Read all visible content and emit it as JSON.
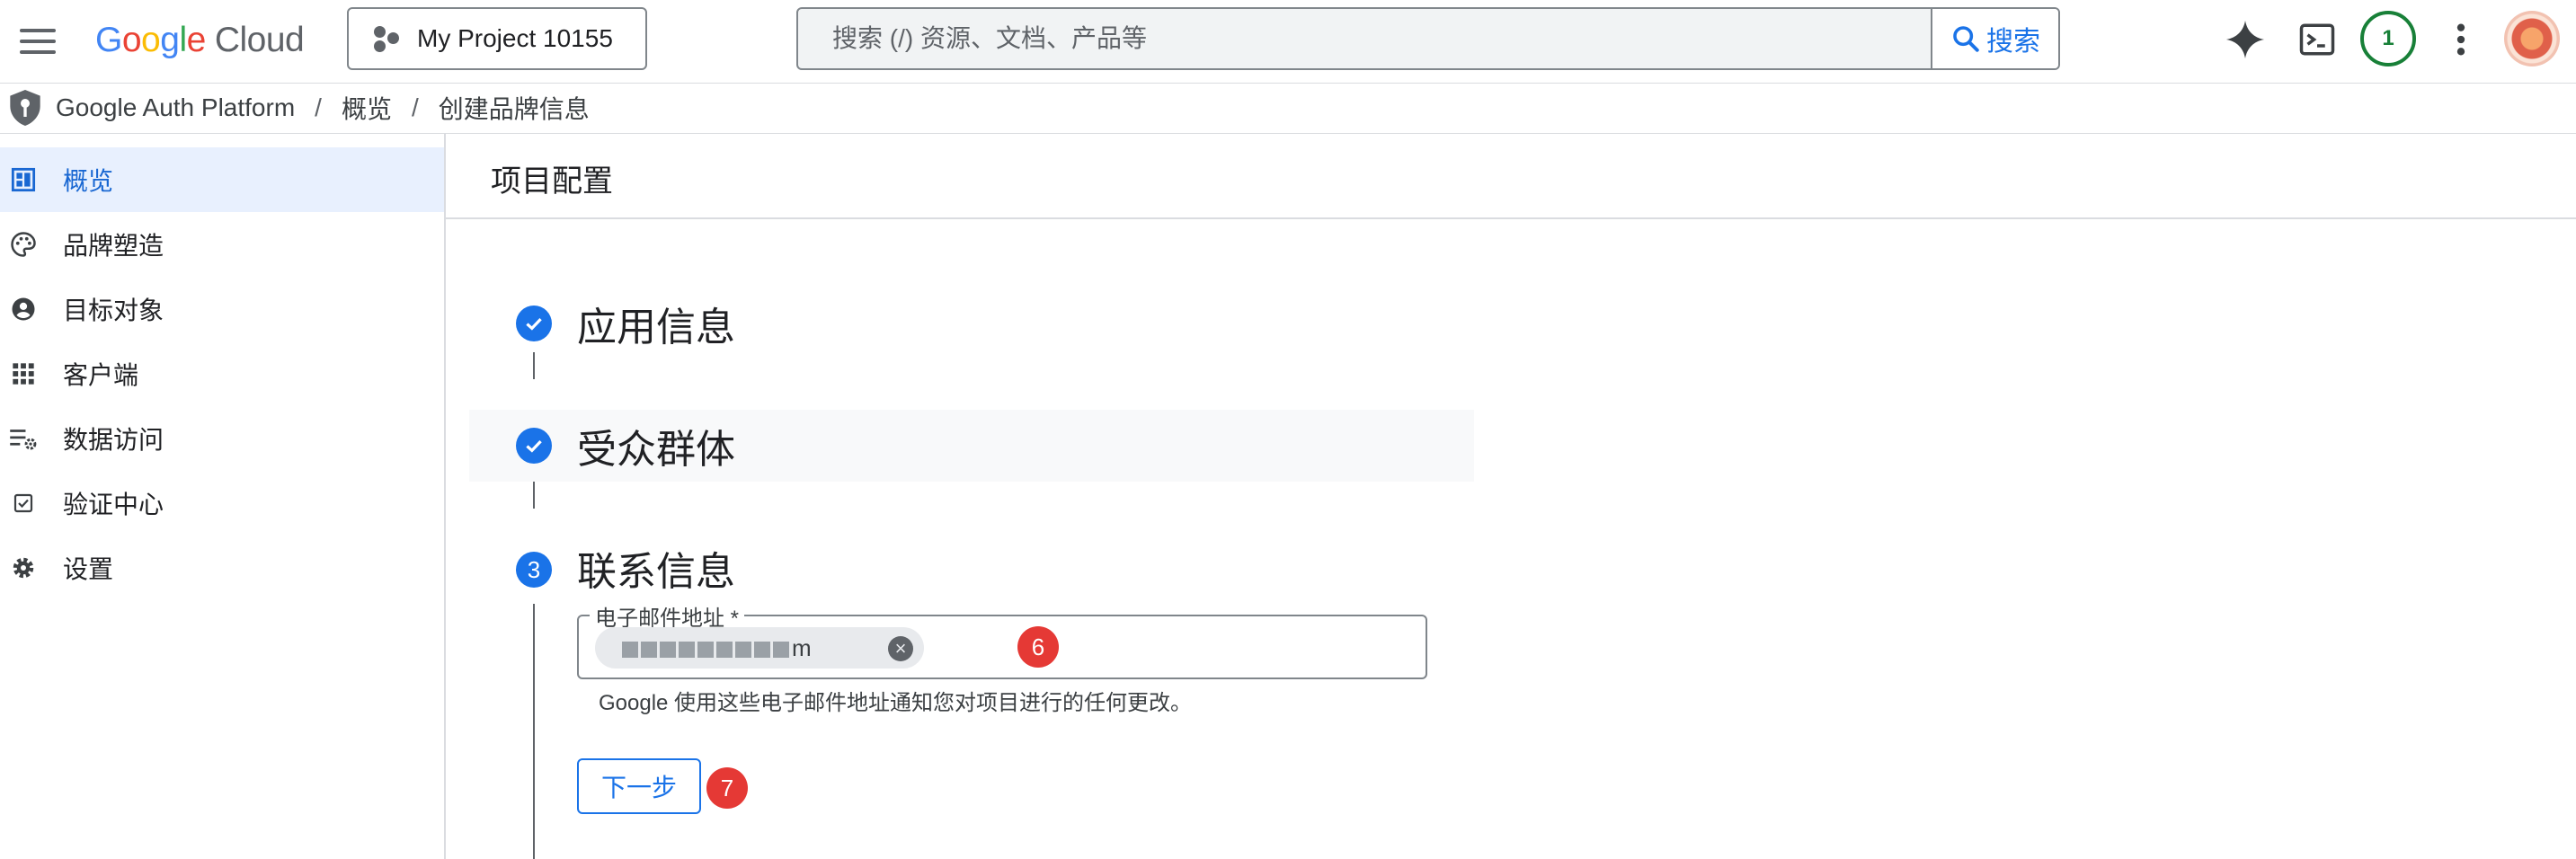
{
  "header": {
    "logo_google": [
      "G",
      "o",
      "o",
      "g",
      "l",
      "e"
    ],
    "logo_cloud": "Cloud",
    "project_label": "My Project 10155",
    "search_placeholder": "搜索 (/) 资源、文档、产品等",
    "search_button": "搜索",
    "notification_count": "1"
  },
  "breadcrumb": {
    "items": [
      "Google Auth Platform",
      "概览",
      "创建品牌信息"
    ],
    "separator": "/"
  },
  "sidebar": {
    "items": [
      {
        "label": "概览",
        "icon": "dashboard-icon",
        "active": true
      },
      {
        "label": "品牌塑造",
        "icon": "palette-icon",
        "active": false
      },
      {
        "label": "目标对象",
        "icon": "account-circle-icon",
        "active": false
      },
      {
        "label": "客户端",
        "icon": "apps-grid-icon",
        "active": false
      },
      {
        "label": "数据访问",
        "icon": "list-settings-icon",
        "active": false
      },
      {
        "label": "验证中心",
        "icon": "checkbox-icon",
        "active": false
      },
      {
        "label": "设置",
        "icon": "gear-icon",
        "active": false
      }
    ]
  },
  "main": {
    "section_title": "项目配置",
    "steps": [
      {
        "title": "应用信息",
        "status": "complete"
      },
      {
        "title": "受众群体",
        "status": "complete"
      },
      {
        "title": "联系信息",
        "status": "active",
        "number": "3"
      }
    ],
    "email_field": {
      "label": "电子邮件地址 *",
      "chip_text": "m",
      "helper": "Google 使用这些电子邮件地址通知您对项目进行的任何更改。"
    },
    "next_button": "下一步",
    "markers": [
      "6",
      "7"
    ]
  },
  "colors": {
    "accent": "#1a73e8",
    "active_bg": "#e8f0fe",
    "marker": "#e53935",
    "notif": "#188038"
  }
}
